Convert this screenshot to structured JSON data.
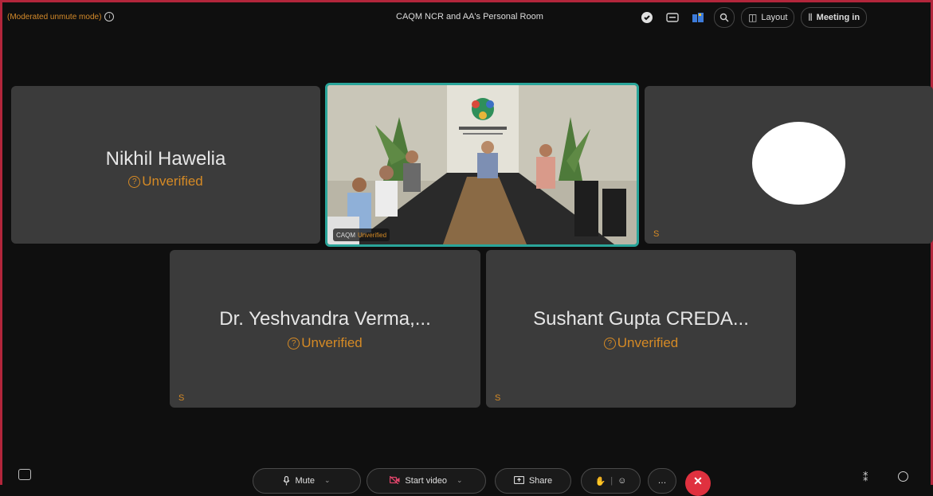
{
  "topbar": {
    "mode_label": "(Moderated unmute mode)",
    "room_title": "CAQM NCR and AA's Personal Room",
    "layout_label": "Layout",
    "meeting_info_label": "Meeting in"
  },
  "participants": [
    {
      "name": "Nikhil Hawelia",
      "status": "Unverified"
    },
    {
      "name": "CAQM",
      "status": "Unverified"
    },
    {
      "name": "",
      "status": "",
      "corner": "S"
    },
    {
      "name": "Dr. Yeshvandra Verma,...",
      "status": "Unverified",
      "corner": "S"
    },
    {
      "name": "Sushant Gupta CREDA...",
      "status": "Unverified",
      "corner": "S"
    }
  ],
  "controls": {
    "mute_label": "Mute",
    "video_label": "Start video",
    "share_label": "Share",
    "end_icon": "close-icon"
  },
  "colors": {
    "accent_teal": "#2aa59a",
    "unverified_orange": "#d58a25",
    "end_red": "#e0313f",
    "frame_red": "#b3263b"
  }
}
